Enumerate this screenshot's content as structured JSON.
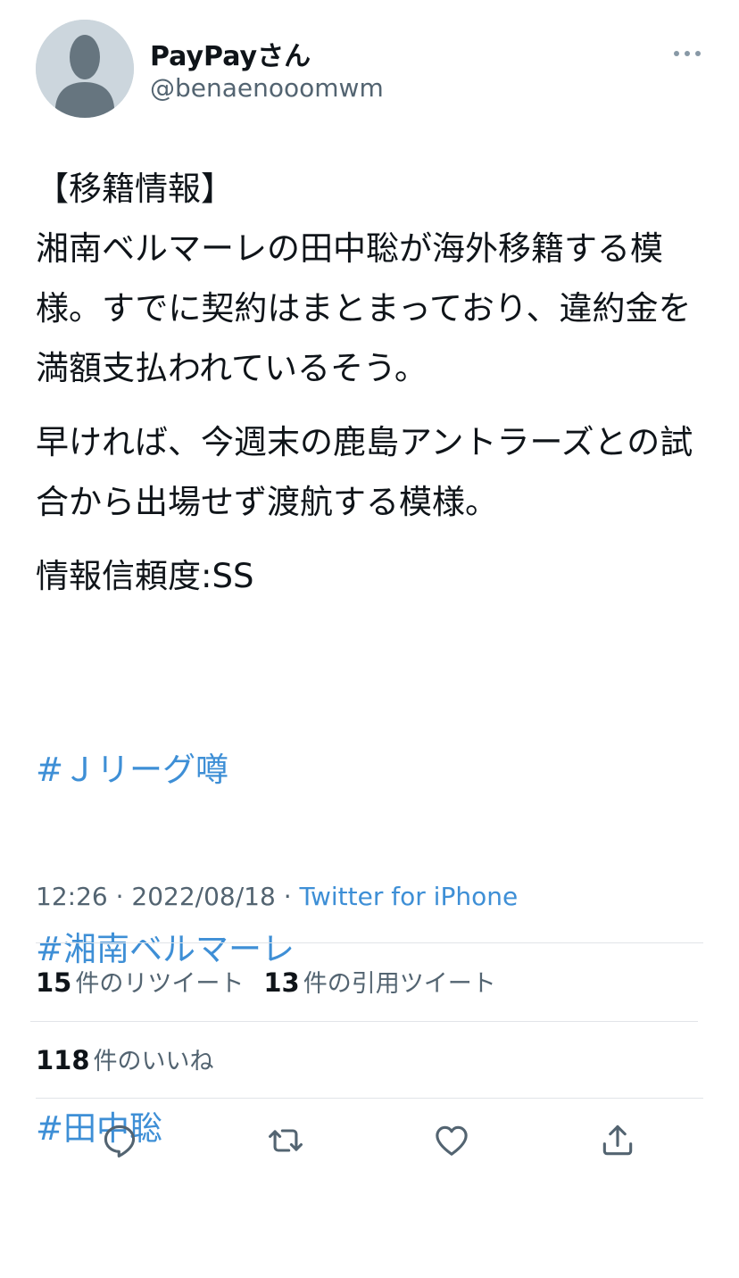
{
  "user": {
    "display_name": "PayPayさん",
    "handle": "@benaenooomwm"
  },
  "tweet": {
    "paragraph_1": "【移籍情報】\n湘南ベルマーレの田中聡が海外移籍する模様。すでに契約はまとまっており、違約金を満額支払われているそう。",
    "paragraph_2": "早ければ、今週末の鹿島アントラーズとの試合から出場せず渡航する模様。",
    "paragraph_3": "情報信頼度:SS",
    "hashtags": [
      "#Ｊリーグ噂",
      "#湘南ベルマーレ",
      "#田中聡"
    ]
  },
  "meta": {
    "time": "12:26",
    "separator": "·",
    "date": "2022/08/18",
    "source": "Twitter for iPhone"
  },
  "stats": {
    "retweets_count": "15",
    "retweets_label": "件のリツイート",
    "quotes_count": "13",
    "quotes_label": "件の引用ツイート",
    "likes_count": "118",
    "likes_label": "件のいいね"
  },
  "icons": {
    "more": "more-icon",
    "reply": "reply-icon",
    "retweet": "retweet-icon",
    "like": "heart-icon",
    "share": "share-icon"
  },
  "colors": {
    "link": "#3e8fd6",
    "secondary_text": "#536471",
    "primary_text": "#0f1419",
    "avatar_bg": "#ccd6dd"
  }
}
